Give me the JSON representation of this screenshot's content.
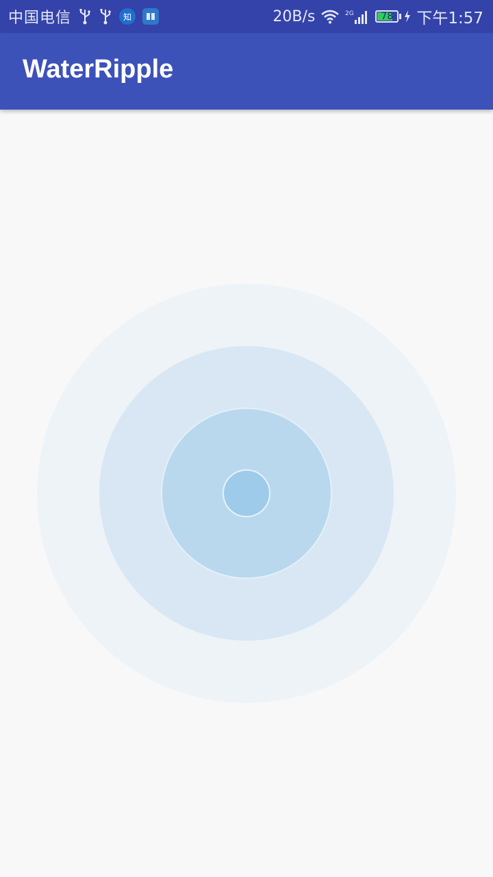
{
  "status_bar": {
    "carrier": "中国电信",
    "left_icons": [
      "usb-icon",
      "usb-icon",
      "zhihu-app-icon",
      "book-app-icon"
    ],
    "zhihu_badge": "知",
    "net_speed": "20B/s",
    "network_type": "2G",
    "battery_level": "78",
    "time": "下午1:57",
    "colors": {
      "background": "#3443a9",
      "battery_fill": "#33cc5a"
    }
  },
  "app_bar": {
    "title": "WaterRipple",
    "background": "#3d52b8"
  },
  "ripple": {
    "colors": [
      "#9ecbe9",
      "#b9d8ed",
      "#d8e7f3",
      "#eef3f8"
    ]
  }
}
